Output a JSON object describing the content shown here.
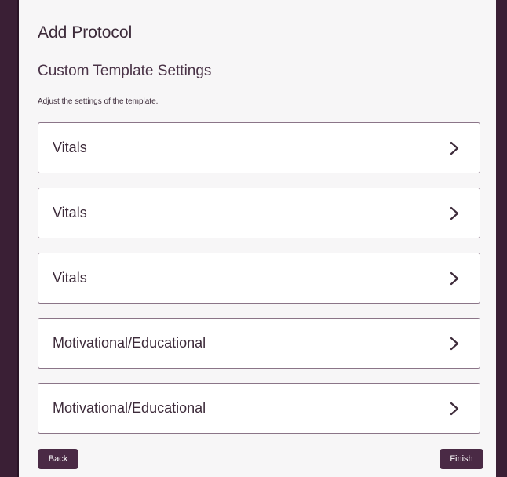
{
  "header": {
    "title": "Add Protocol",
    "subtitle": "Custom Template Settings",
    "description": "Adjust the settings of the template."
  },
  "settings": {
    "items": [
      {
        "label": "Vitals",
        "icon": "chevron-right-icon"
      },
      {
        "label": "Vitals",
        "icon": "chevron-right-icon"
      },
      {
        "label": "Vitals",
        "icon": "chevron-right-icon"
      },
      {
        "label": "Motivational/Educational",
        "icon": "chevron-right-icon"
      },
      {
        "label": "Motivational/Educational",
        "icon": "chevron-right-icon"
      }
    ]
  },
  "footer": {
    "back_label": "Back",
    "finish_label": "Finish"
  },
  "colors": {
    "frame": "#3a1f35",
    "button": "#4a2a45",
    "border": "#8b7588",
    "text": "#3d2b3a"
  }
}
